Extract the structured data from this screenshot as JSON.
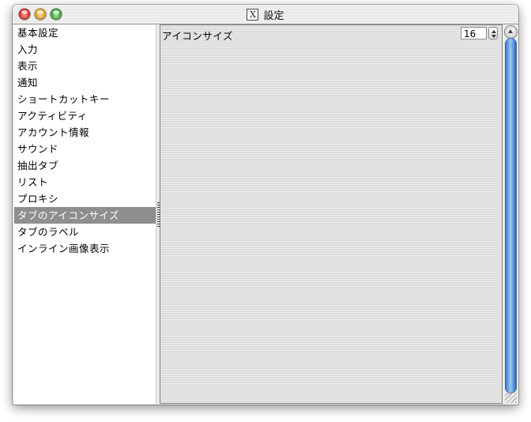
{
  "window": {
    "title": "設定",
    "title_icon": "x11-icon"
  },
  "sidebar": {
    "items": [
      {
        "label": "基本設定"
      },
      {
        "label": "入力"
      },
      {
        "label": "表示"
      },
      {
        "label": "通知"
      },
      {
        "label": "ショートカットキー"
      },
      {
        "label": "アクティビティ"
      },
      {
        "label": "アカウント情報"
      },
      {
        "label": "サウンド"
      },
      {
        "label": "抽出タブ"
      },
      {
        "label": "リスト"
      },
      {
        "label": "プロキシ"
      },
      {
        "label": "タブのアイコンサイズ"
      },
      {
        "label": "タブのラベル"
      },
      {
        "label": "インライン画像表示"
      }
    ],
    "selected_index": 11
  },
  "panel": {
    "setting_label": "アイコンサイズ",
    "icon_size_value": "16"
  },
  "colors": {
    "selection": "#8e8e8e",
    "scroll_thumb": "#5f98dd"
  }
}
